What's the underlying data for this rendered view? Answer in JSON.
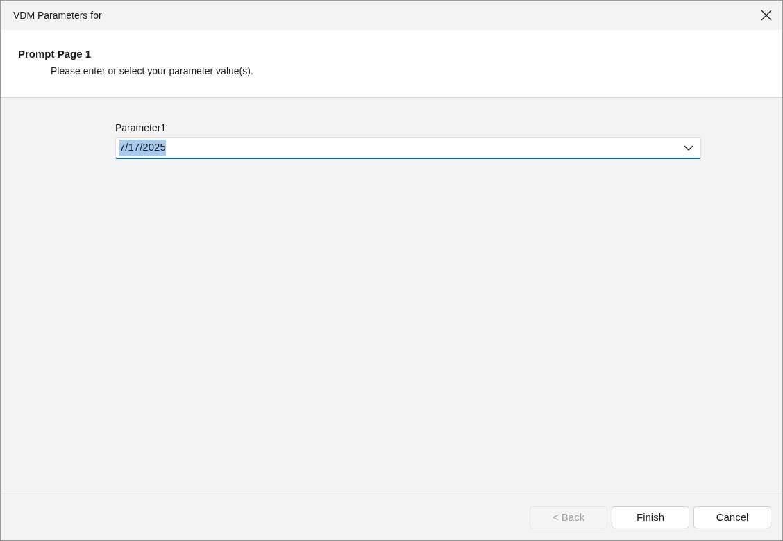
{
  "window": {
    "title": "VDM Parameters for"
  },
  "header": {
    "title": "Prompt Page 1",
    "subtitle": "Please enter or select your parameter value(s)."
  },
  "parameter": {
    "label": "Parameter1",
    "value": "7/17/2025",
    "text_selected": true
  },
  "buttons": [
    {
      "mnemonic": "B",
      "rest": "ack",
      "prefix": "< ",
      "disabled": true
    },
    {
      "mnemonic": "F",
      "rest": "inish",
      "disabled": false
    },
    {
      "rest": "Cancel",
      "disabled": false
    }
  ]
}
